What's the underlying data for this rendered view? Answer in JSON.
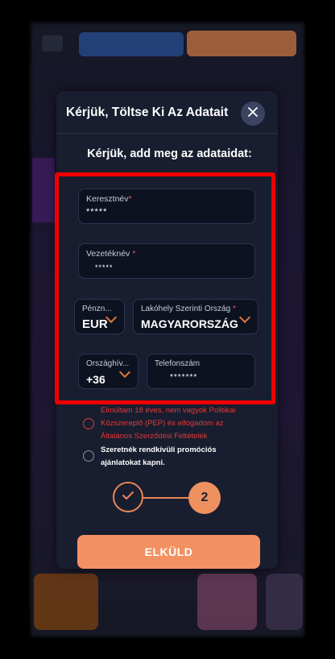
{
  "modal": {
    "title": "Kérjük, Töltse Ki Az Adatait",
    "subtitle": "Kérjük, add meg az adataidat:"
  },
  "form": {
    "first_name": {
      "label": "Keresztnév",
      "required_mark": "*",
      "value": "*****"
    },
    "last_name": {
      "label": "Vezetéknév",
      "required_mark": "*",
      "value": "*****"
    },
    "currency": {
      "label": "Pénzn...",
      "value": "EUR"
    },
    "country": {
      "label": "Lakóhely Szerinti Ország",
      "required_mark": "*",
      "value": "MAGYARORSZÁG"
    },
    "dial_code": {
      "label": "Országhív...",
      "value": "+36"
    },
    "phone": {
      "label": "Telefonszám",
      "value": "*******"
    }
  },
  "consents": {
    "terms": "Elmúltam 18 éves, nem vagyok Politikai Közszereplő (PEP) és elfogadom az Általános Szerződési Feltételek",
    "promo": "Szeretnék rendkívüli promóciós ajánlatokat kapni."
  },
  "stepper": {
    "current_step": 2,
    "completed_step_icon": "check-icon",
    "step2_label": "2"
  },
  "submit_label": "ELKÜLD",
  "colors": {
    "accent": "#f39162",
    "highlight": "#ee0000",
    "modal_bg": "#181d2f",
    "error_text": "#e23a3a"
  }
}
